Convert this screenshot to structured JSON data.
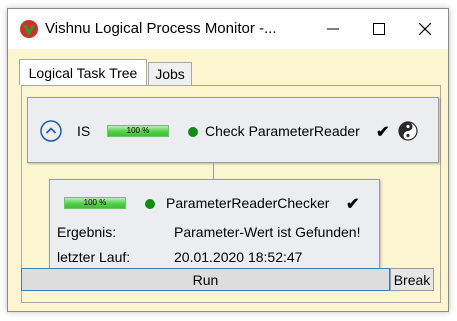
{
  "window": {
    "title": "Vishnu Logical Process Monitor -..."
  },
  "tabs": [
    {
      "label": "Logical Task Tree",
      "active": true
    },
    {
      "label": "Jobs",
      "active": false
    }
  ],
  "tree": {
    "root": {
      "name": "IS",
      "progress_label": "100 %",
      "progress_fraction": 1.0,
      "status_color": "#138a13",
      "task": "Check ParameterReader",
      "check_glyph": "✔",
      "icons": [
        "collapse-chevron-up-icon",
        "yin-yang-icon"
      ]
    },
    "child": {
      "progress_label": "100 %",
      "progress_fraction": 1.0,
      "status_color": "#138a13",
      "task": "ParameterReaderChecker",
      "check_glyph": "✔",
      "result_label": "Ergebnis:",
      "result_value": "Parameter-Wert ist Gefunden!",
      "last_run_label": "letzter Lauf:",
      "last_run_value": "20.01.2020 18:52:47"
    }
  },
  "buttons": {
    "run": "Run",
    "break": "Break"
  },
  "colors": {
    "window_background": "#fbf6cf",
    "node_background": "#ecedf1",
    "progress_green": "#53d148",
    "accent_blue": "#1e5aa8"
  }
}
